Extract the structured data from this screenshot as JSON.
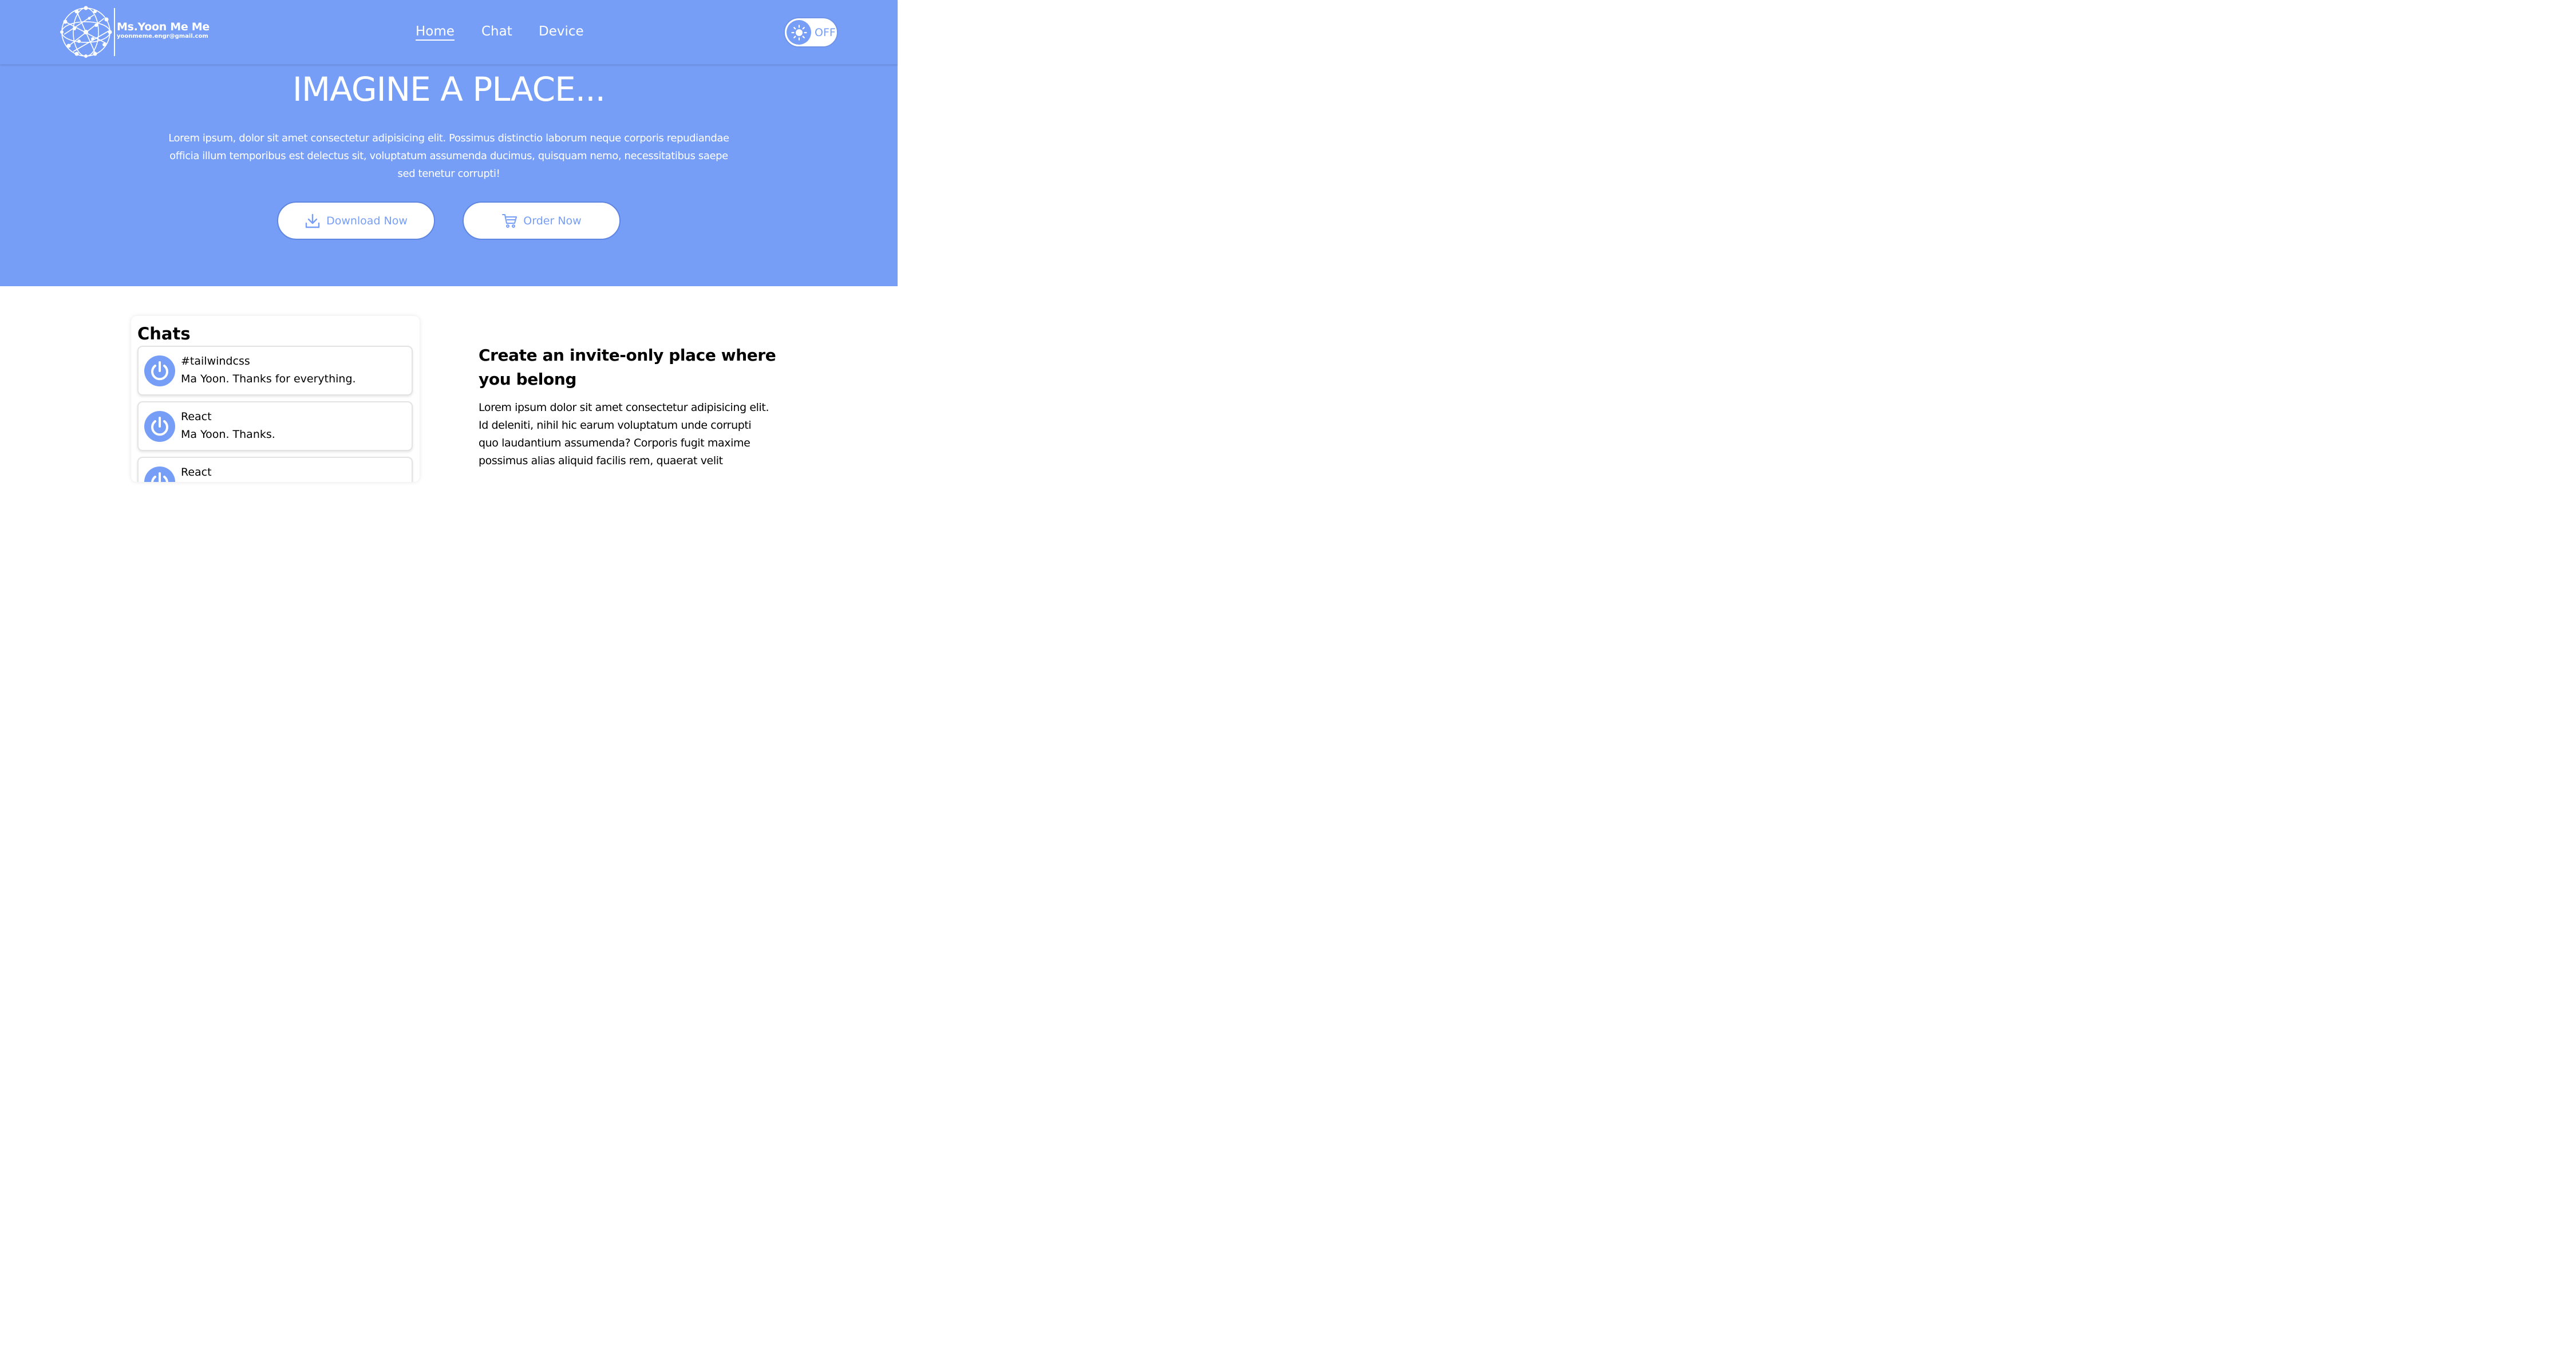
{
  "brand": {
    "name": "Ms.Yoon Me Me",
    "email": "yoonmeme.engr@gmail.com",
    "logo_icon": "globe-network-icon"
  },
  "nav": {
    "items": [
      {
        "label": "Home",
        "active": true
      },
      {
        "label": "Chat",
        "active": false
      },
      {
        "label": "Device",
        "active": false
      }
    ]
  },
  "theme_toggle": {
    "label": "OFF",
    "icon": "sun-icon"
  },
  "hero": {
    "title": "IMAGINE A PLACE...",
    "description": "Lorem ipsum, dolor sit amet consectetur adipisicing elit. Possimus distinctio laborum neque corporis repudiandae officia illum temporibus est delectus sit, voluptatum assumenda ducimus, quisquam nemo, necessitatibus saepe sed tenetur corrupti!",
    "buttons": [
      {
        "label": "Download Now",
        "icon": "download-icon"
      },
      {
        "label": "Order Now",
        "icon": "cart-icon"
      }
    ]
  },
  "chats": {
    "title": "Chats",
    "items": [
      {
        "name": "#tailwindcss",
        "message": "Ma Yoon. Thanks for everything.",
        "icon": "power-icon"
      },
      {
        "name": "React",
        "message": "Ma Yoon. Thanks.",
        "icon": "power-icon"
      },
      {
        "name": "React",
        "message": "",
        "icon": "power-icon"
      }
    ]
  },
  "feature": {
    "title": "Create an invite-only place where you belong",
    "text": "Lorem ipsum dolor sit amet consectetur adipisicing elit. Id deleniti, nihil hic earum voluptatum unde corrupti quo laudantium assumenda? Corporis fugit maxime possimus alias aliquid facilis rem, quaerat velit"
  },
  "colors": {
    "primary": "#769ef6",
    "white": "#ffffff",
    "text": "#000000"
  }
}
